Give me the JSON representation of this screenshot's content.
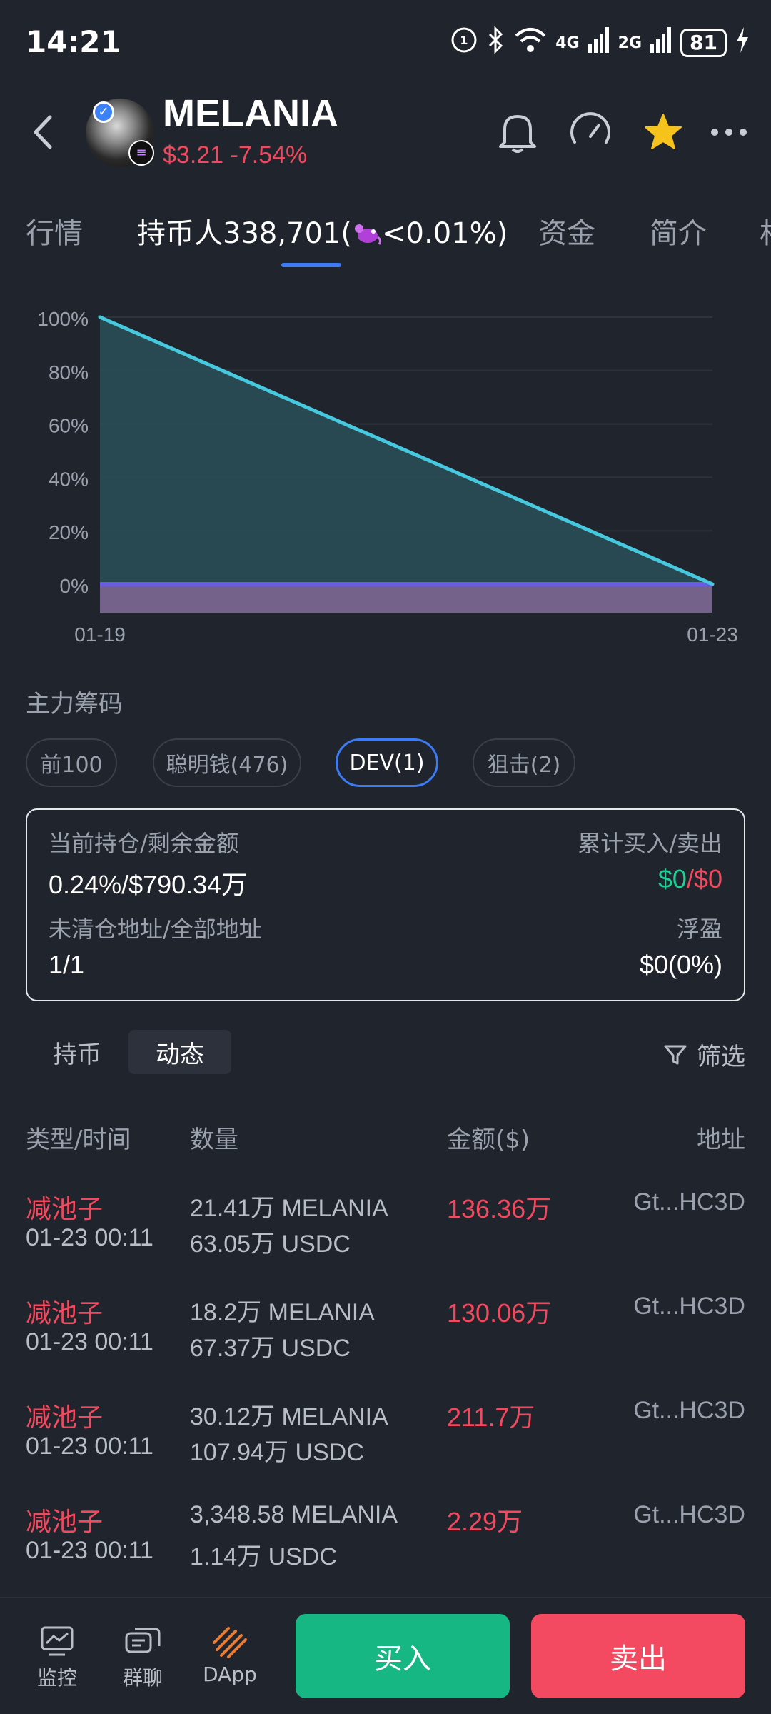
{
  "status_bar": {
    "time": "14:21",
    "net1": "4G",
    "net2": "2G",
    "battery": "81"
  },
  "header": {
    "token": "MELANIA",
    "price": "$3.21",
    "change": "-7.54%"
  },
  "tabs": [
    {
      "label": "行情",
      "active": false
    },
    {
      "label": "持币人338,701(",
      "suffix": "<0.01%)",
      "active": true
    },
    {
      "label": "资金",
      "active": false
    },
    {
      "label": "简介",
      "active": false
    },
    {
      "label": "相",
      "active": false
    }
  ],
  "chart_data": {
    "type": "area",
    "x": [
      "01-19",
      "01-23"
    ],
    "series": [
      {
        "values": [
          100,
          0
        ],
        "color": "#46c9de"
      },
      {
        "values": [
          0,
          0
        ],
        "color": "#6a5ce0"
      }
    ],
    "y_ticks": [
      "100%",
      "80%",
      "60%",
      "40%",
      "20%",
      "0%"
    ],
    "ylim": [
      0,
      100
    ],
    "grid": true
  },
  "section": {
    "title": "主力筹码",
    "chips": [
      {
        "label": "前100",
        "active": false
      },
      {
        "label": "聪明钱(476)",
        "active": false
      },
      {
        "label": "DEV(1)",
        "active": true
      },
      {
        "label": "狙击(2)",
        "active": false
      }
    ]
  },
  "summary": {
    "holding_label": "当前持仓/剩余金额",
    "holding_value": "0.24%/$790.34万",
    "bought_sold_label": "累计买入/卖出",
    "bought": "$0",
    "sep": "/",
    "sold": "$0",
    "addresses_label": "未清仓地址/全部地址",
    "addresses_value": "1/1",
    "pnl_label": "浮盈",
    "pnl_value": "$0(0%)"
  },
  "subtabs": {
    "holding": "持币",
    "activity": "动态",
    "filter": "筛选"
  },
  "table": {
    "headers": {
      "type_time": "类型/时间",
      "quantity": "数量",
      "amount": "金额($)",
      "address": "地址"
    },
    "rows": [
      {
        "type": "减池子",
        "time": "01-23 00:11",
        "q1": "21.41万 MELANIA",
        "q2": "63.05万 USDC",
        "amount": "136.36万",
        "address": "Gt...HC3D"
      },
      {
        "type": "减池子",
        "time": "01-23 00:11",
        "q1": "18.2万 MELANIA",
        "q2": "67.37万 USDC",
        "amount": "130.06万",
        "address": "Gt...HC3D"
      },
      {
        "type": "减池子",
        "time": "01-23 00:11",
        "q1": "30.12万 MELANIA",
        "q2": "107.94万 USDC",
        "amount": "211.7万",
        "address": "Gt...HC3D"
      },
      {
        "type": "减池子",
        "time": "01-23 00:11",
        "q1": "3,348.58 MELANIA",
        "q2": "1.14万 USDC",
        "amount": "2.29万",
        "address": "Gt...HC3D"
      }
    ]
  },
  "bottom_bar": {
    "monitor": "监控",
    "chat": "群聊",
    "dapp": "DApp",
    "buy": "买入",
    "sell": "卖出"
  },
  "colors": {
    "background": "#20242c",
    "up": "#1fcf94",
    "down": "#f2495e",
    "accent": "#3b7bf6",
    "buy": "#17b784",
    "sell": "#f34a61"
  }
}
